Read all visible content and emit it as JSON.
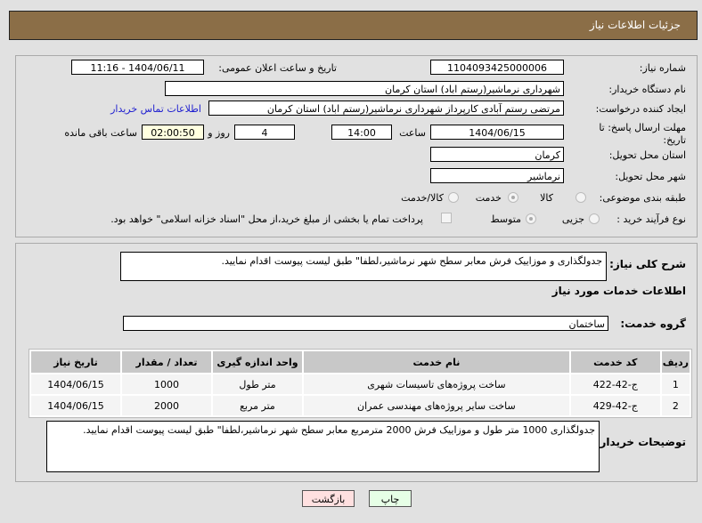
{
  "header": {
    "title": "جزئیات اطلاعات نیاز"
  },
  "form": {
    "need_number_label": "شماره نیاز:",
    "need_number": "1104093425000006",
    "announce_label": "تاریخ و ساعت اعلان عمومی:",
    "announce_value": "1404/06/11 - 11:16",
    "buyer_label": "نام دستگاه خریدار:",
    "buyer": "شهرداری نرماشیر(رستم اباد) استان کرمان",
    "creator_label": "ایجاد کننده درخواست:",
    "creator": "مرتضی رستم آبادی کارپرداز شهرداری نرماشیر(رستم اباد) استان کرمان",
    "contact_link": "اطلاعات تماس خریدار",
    "deadline_label": "مهلت ارسال پاسخ: تا تاریخ:",
    "deadline_date": "1404/06/15",
    "time_label": "ساعت",
    "deadline_time": "14:00",
    "days": "4",
    "days_label": "روز و",
    "remaining": "02:00:50",
    "remaining_label": "ساعت باقی مانده",
    "province_label": "استان محل تحویل:",
    "province": "کرمان",
    "city_label": "شهر محل تحویل:",
    "city": "نرماشیر",
    "category_label": "طبقه بندی موضوعی:",
    "category_options": [
      "کالا",
      "خدمت",
      "کالا/خدمت"
    ],
    "category_selected": "خدمت",
    "process_label": "نوع فرآیند خرید :",
    "process_options": [
      "جزیی",
      "متوسط"
    ],
    "process_selected": "متوسط",
    "payment_note": "پرداخت تمام یا بخشی از مبلغ خرید،از محل \"اسناد خزانه اسلامی\" خواهد بود."
  },
  "details": {
    "summary_label": "شرح کلی نیاز:",
    "summary": "جدولگذاری و موزاییک فرش معابر سطح شهر نرماشیر،لطفا\" طبق لیست پیوست اقدام نمایید.",
    "services_title": "اطلاعات خدمات مورد نیاز",
    "group_label": "گروه خدمت:",
    "group": "ساختمان",
    "table": {
      "headers": [
        "ردیف",
        "کد خدمت",
        "نام خدمت",
        "واحد اندازه گیری",
        "تعداد / مقدار",
        "تاریخ نیاز"
      ],
      "rows": [
        [
          "1",
          "ج-42-422",
          "ساخت پروژه‌های تاسیسات شهری",
          "متر طول",
          "1000",
          "1404/06/15"
        ],
        [
          "2",
          "ج-42-429",
          "ساخت سایر پروژه‌های مهندسی عمران",
          "متر مربع",
          "2000",
          "1404/06/15"
        ]
      ]
    },
    "notes_label": "توضیحات خریدار:",
    "notes": "جدولگذاری 1000 متر طول و موزاییک فرش 2000 مترمربع معابر سطح شهر نرماشیر،لطفا\" طبق لیست پیوست اقدام نمایید."
  },
  "buttons": {
    "print": "چاپ",
    "back": "بازگشت",
    "print_color": "#e6ffe6",
    "back_color": "#ffe0e0"
  }
}
